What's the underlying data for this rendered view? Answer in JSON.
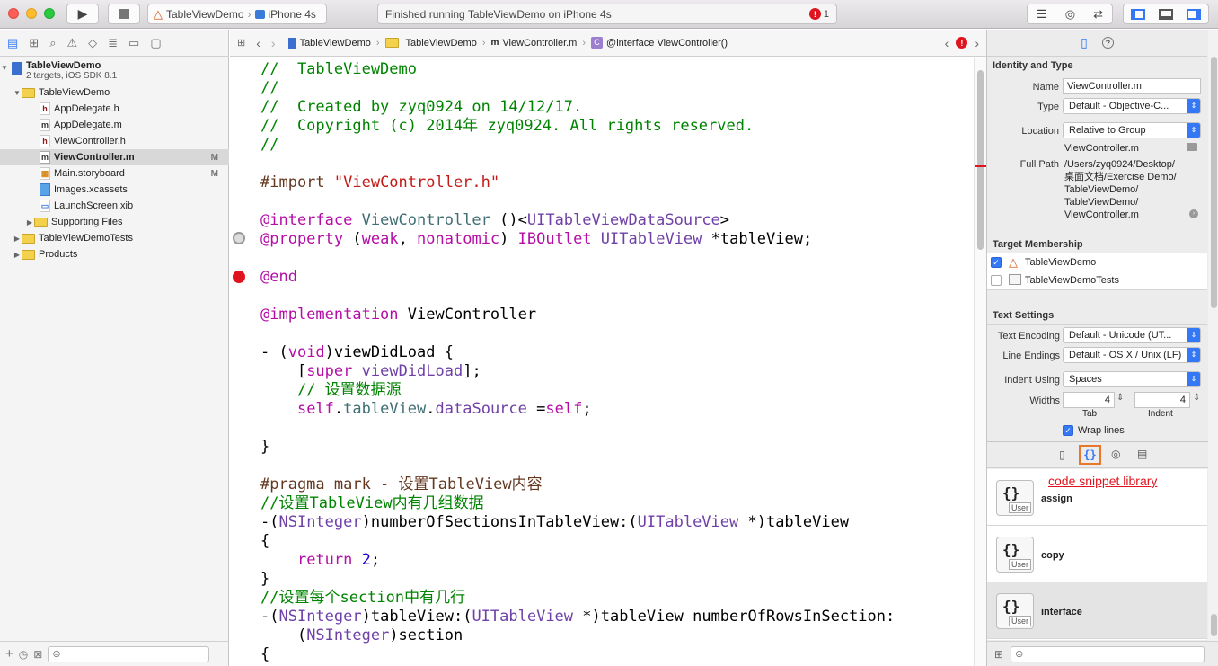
{
  "toolbar": {
    "scheme_target": "TableViewDemo",
    "scheme_device": "iPhone 4s",
    "activity_text": "Finished running TableViewDemo on iPhone 4s",
    "error_count": "1"
  },
  "jumpbar": {
    "crumbs": [
      "TableViewDemo",
      "TableViewDemo",
      "ViewController.m",
      "@interface ViewController()"
    ]
  },
  "navigator": {
    "project_name": "TableViewDemo",
    "project_sub": "2 targets, iOS SDK 8.1",
    "items": [
      {
        "label": "TableViewDemo",
        "badge": ""
      },
      {
        "label": "AppDelegate.h",
        "badge": ""
      },
      {
        "label": "AppDelegate.m",
        "badge": ""
      },
      {
        "label": "ViewController.h",
        "badge": ""
      },
      {
        "label": "ViewController.m",
        "badge": "M"
      },
      {
        "label": "Main.storyboard",
        "badge": "M"
      },
      {
        "label": "Images.xcassets",
        "badge": ""
      },
      {
        "label": "LaunchScreen.xib",
        "badge": ""
      },
      {
        "label": "Supporting Files",
        "badge": ""
      },
      {
        "label": "TableViewDemoTests",
        "badge": ""
      },
      {
        "label": "Products",
        "badge": ""
      }
    ]
  },
  "code": {
    "lines": [
      "//  TableViewDemo",
      "//",
      "//  Created by zyq0924 on 14/12/17.",
      "//  Copyright (c) 2014年 zyq0924. All rights reserved.",
      "//",
      "",
      "#import \"ViewController.h\"",
      "",
      "@interface ViewController ()<UITableViewDataSource>",
      "@property (weak, nonatomic) IBOutlet UITableView *tableView;",
      "",
      "@end",
      "",
      "@implementation ViewController",
      "",
      "- (void)viewDidLoad {",
      "    [super viewDidLoad];",
      "    // 设置数据源",
      "    self.tableView.dataSource =self;",
      "",
      "}",
      "",
      "#pragma mark - 设置TableView内容",
      "//设置TableView内有几组数据",
      "-(NSInteger)numberOfSectionsInTableView:(UITableView *)tableView",
      "{",
      "    return 2;",
      "}",
      "//设置每个section中有几行",
      "-(NSInteger)tableView:(UITableView *)tableView numberOfRowsInSection:",
      "    (NSInteger)section",
      "{"
    ]
  },
  "inspector": {
    "identity_header": "Identity and Type",
    "name_label": "Name",
    "name_value": "ViewController.m",
    "type_label": "Type",
    "type_value": "Default - Objective-C...",
    "location_label": "Location",
    "location_value": "Relative to Group",
    "location_file": "ViewController.m",
    "fullpath_label": "Full Path",
    "fullpath_lines": [
      "/Users/zyq0924/Desktop/",
      "桌面文档/Exercise Demo/",
      "TableViewDemo/",
      "TableViewDemo/",
      "ViewController.m"
    ],
    "target_header": "Target Membership",
    "targets": [
      {
        "label": "TableViewDemo",
        "checked": true
      },
      {
        "label": "TableViewDemoTests",
        "checked": false
      }
    ],
    "text_header": "Text Settings",
    "encoding_label": "Text Encoding",
    "encoding_value": "Default - Unicode (UT...",
    "endings_label": "Line Endings",
    "endings_value": "Default - OS X / Unix (LF)",
    "indent_label": "Indent Using",
    "indent_value": "Spaces",
    "widths_label": "Widths",
    "tab_value": "4",
    "indent_width_value": "4",
    "tab_label": "Tab",
    "indent_sub_label": "Indent",
    "wrap_label": "Wrap lines",
    "annotation": "code snippet library",
    "snippets": [
      "assign",
      "copy",
      "interface"
    ],
    "user_badge": "User"
  },
  "colors": {
    "comment": "#008400",
    "keyword": "#b40ea6",
    "type": "#6f41a7",
    "string": "#c41a16",
    "accent": "#3478f6",
    "annotation": "#e0141e"
  }
}
